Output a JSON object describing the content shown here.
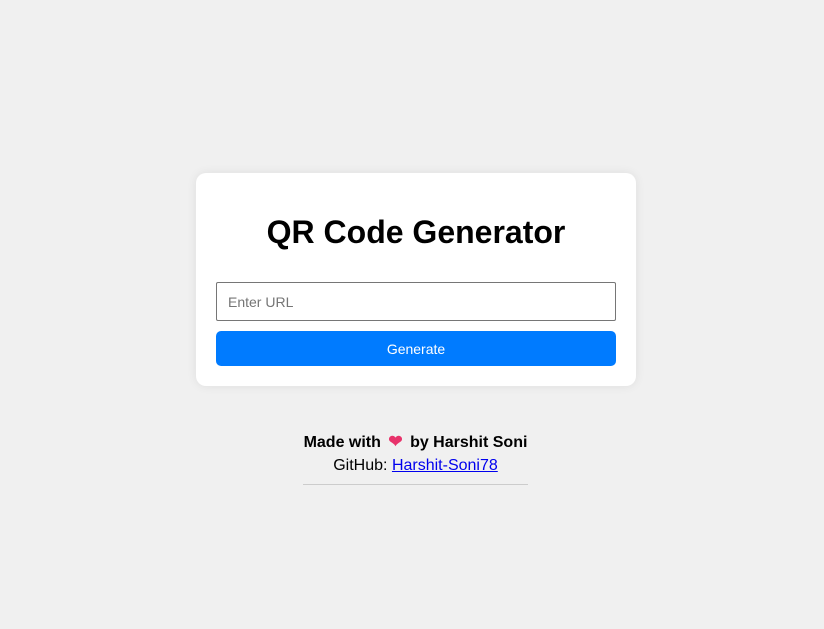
{
  "card": {
    "title": "QR Code Generator",
    "url_input": {
      "value": "",
      "placeholder": "Enter URL"
    },
    "generate_label": "Generate"
  },
  "footer": {
    "made_with": "Made with",
    "heart_icon": "heart-icon",
    "by_author": "by Harshit Soni",
    "github_prefix": "GitHub:",
    "github_link_text": "Harshit-Soni78"
  },
  "colors": {
    "background": "#f0f0f0",
    "card": "#ffffff",
    "button": "#007bff",
    "heart": "#e8336b",
    "link": "#0000ee"
  }
}
